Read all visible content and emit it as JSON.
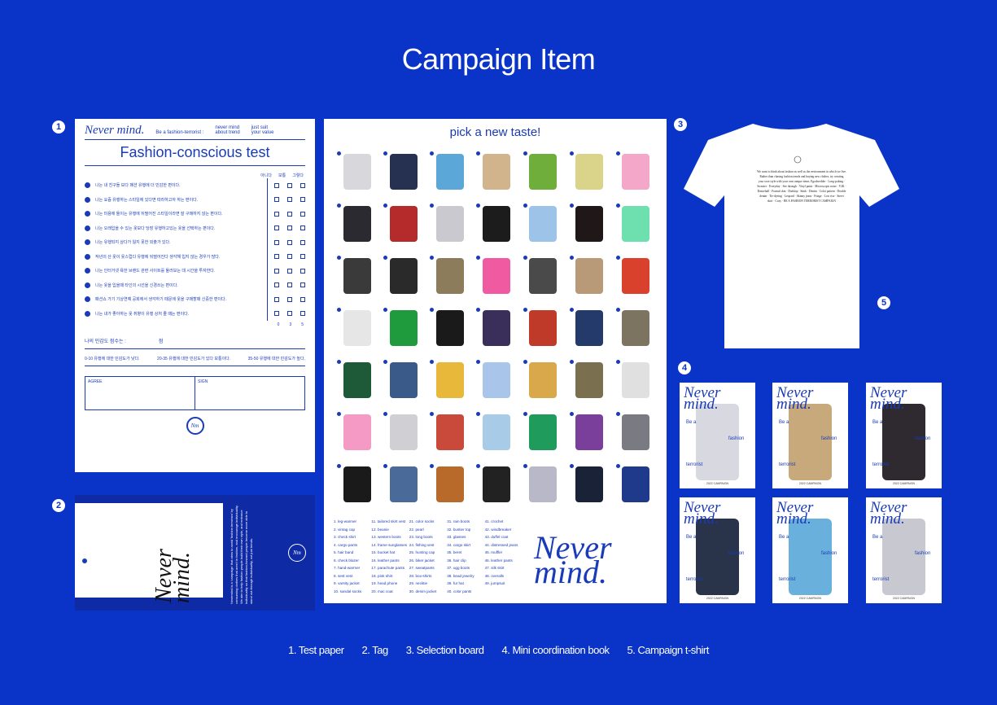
{
  "title": "Campaign Item",
  "markers": {
    "m1": "1",
    "m2": "2",
    "m3": "3",
    "m4": "4",
    "m5": "5"
  },
  "test_paper": {
    "logo": "Never mind.",
    "tagline": "Be a fashion-terrorist :",
    "line1": "never mind",
    "line1b": "about trend",
    "line2": "just suit",
    "line2b": "your value",
    "heading": "Fashion-conscious test",
    "options": [
      "아니다",
      "보통",
      "그렇다"
    ],
    "questions": [
      "나는 내 친구들 보다 패션 유행에 더 민감한 편이다.",
      "나는 요즘 유행하는 스타일에 있다면 따라하고자 하는 편이다.",
      "나는 미용에 들이는 유행에 뒤떨어진 스타일이라면 잘 구매하지 않는 편이다.",
      "나는 오래입을 수 있는 옷보다 당장 유행하고있는 옷을 선택하는 편이다.",
      "나는 유행되지 상다가 잃지 못한 외출가 있다.",
      "작년의 산 옷이 옷스럽다 유행에 뒤떨어진다 생각해 입지 않는 경우가 많다.",
      "나는 인터거넷 욕한 브랜드 관련 사이트를 둘러보는 데 시간을 투자한다.",
      "나는 옷을 입을때 타인의 시선을 신경쓰는 편이다.",
      "패션쇼 가기 기상연예 공회에서 생각하기 때문에 옷을 구매할때 신중한 편이다.",
      "나는 내가 좋아하는 옷 취향이 유행 상처 줄 때는 편이다."
    ],
    "score_label": "나의 민감도 점수는 :",
    "score_unit": "점",
    "col_totals": [
      "0",
      "3",
      "5"
    ],
    "levels": [
      "0-10  유행에 대한 민감도가 낮다.",
      "20-35  유행에 대한 민감도가 있다 보통이다.",
      "35-50  유행에 대한 민감도가 높다."
    ],
    "agree": "AGREE",
    "sign": "SIGN",
    "seal": "Nm"
  },
  "tag": {
    "brand": "Never mind.",
    "blurb": "Nevermind is a 'campaign' that aims to avoid 'fashion terrorism' by consuming clothes that aren't in fashion, and encourage individuality. We aim to help fashion people build their own style, and embrace individuality so that fashion-forward people become more able to stand out through individuality, not just trends.",
    "mark": "Nm"
  },
  "board": {
    "title": "pick a new taste!",
    "items": [
      {
        "c": "#d8d8dc"
      },
      {
        "c": "#263050"
      },
      {
        "c": "#5aa7d8"
      },
      {
        "c": "#d2b48c"
      },
      {
        "c": "#6fae3a"
      },
      {
        "c": "#d9d48a"
      },
      {
        "c": "#f4a7c8"
      },
      {
        "c": "#2a2a30"
      },
      {
        "c": "#b52a2a"
      },
      {
        "c": "#c9c9cf"
      },
      {
        "c": "#1c1c1c"
      },
      {
        "c": "#9ec3e8"
      },
      {
        "c": "#201818"
      },
      {
        "c": "#6ee0b0"
      },
      {
        "c": "#3a3a3a"
      },
      {
        "c": "#2a2a2a"
      },
      {
        "c": "#8c7c5c"
      },
      {
        "c": "#f05aa0"
      },
      {
        "c": "#4a4a4a"
      },
      {
        "c": "#b89a78"
      },
      {
        "c": "#d9412c"
      },
      {
        "c": "#e6e6e6"
      },
      {
        "c": "#1f9a3c"
      },
      {
        "c": "#1a1a1a"
      },
      {
        "c": "#3a2f5a"
      },
      {
        "c": "#c03a2a"
      },
      {
        "c": "#233a6a"
      },
      {
        "c": "#7c7460"
      },
      {
        "c": "#1f5a38"
      },
      {
        "c": "#3a5a8a"
      },
      {
        "c": "#e8b83a"
      },
      {
        "c": "#a9c6ea"
      },
      {
        "c": "#d9a84a"
      },
      {
        "c": "#7a7050"
      },
      {
        "c": "#e0e0e0"
      },
      {
        "c": "#f59ac4"
      },
      {
        "c": "#d0d0d4"
      },
      {
        "c": "#c94a3a"
      },
      {
        "c": "#a8cce8"
      },
      {
        "c": "#1f9c5c"
      },
      {
        "c": "#7a3f9a"
      },
      {
        "c": "#7a7a82"
      },
      {
        "c": "#1a1a1a"
      },
      {
        "c": "#4a6a9a"
      },
      {
        "c": "#b86a2a"
      },
      {
        "c": "#222222"
      },
      {
        "c": "#b8b8c8"
      },
      {
        "c": "#1a2238"
      },
      {
        "c": "#1f3a8a"
      }
    ],
    "legend": [
      "1. leg-warmer",
      "11. tailored skirt vest",
      "21. color socks",
      "31. rain boots",
      "41. crochet",
      "2. vintag cap",
      "12. beanie",
      "22. pearl",
      "32. bustier top",
      "42. windbreaker",
      "3. check shirt",
      "13. western boots",
      "23. long boots",
      "33. glasses",
      "43. duffel coat",
      "4. cargo pants",
      "14. frame sunglasses",
      "24. fishing vest",
      "34. cargo skirt",
      "44. distressed jeans",
      "5. hair band",
      "15. bucket hat",
      "25. hunting cap",
      "35. beret",
      "45. muffler",
      "6. check blazer",
      "16. leather pants",
      "26. biker jacket",
      "36. hair clip",
      "46. leather pants",
      "7. hand-warmer",
      "17. parachute pants",
      "27. sweatpants",
      "37. ugg boots",
      "47. silk skirt",
      "8. sest vest",
      "18. pink shirt",
      "28. box-shirts",
      "38. bead jewelry",
      "48. overalls",
      "9. varsity jacket",
      "19. head phone",
      "29. necktie",
      "39. fur hat",
      "49. jumpsuit",
      "10. sandal socks",
      "20. mac coat",
      "30. denim jacket",
      "40. color pants",
      ""
    ],
    "brand": "Never mind."
  },
  "shirt": {
    "text": "We want to think about fashion as well as the environment in which we live. Rather than chasing fashion trends and buying new clothes, try creating your own style with your own unique items. Egoshredder · Long-poking · Sweater · Everyday · See through · Vinyl pants · Microscopic noise · Y2K · Dancehall · Formal skin · Dadslop · Stink · Denim · Color pattern · Double denim · Tie-dyeing · Leopard · Skinny jeans · Fringe · Low rise · Street skirt · Cozy · BE A FASHION TERRORIST CAMPAIGN"
  },
  "books": [
    {
      "brand": "Never mind.",
      "be": "Be a",
      "fashion": "fashion",
      "terrorist": "terrorist",
      "year": "2022 CAMPAIGN",
      "c": "#d8d8e0"
    },
    {
      "brand": "Never mind.",
      "be": "Be a",
      "fashion": "fashion",
      "terrorist": "terrorist",
      "year": "2022 CAMPAIGN",
      "c": "#c7a97c"
    },
    {
      "brand": "Never mind.",
      "be": "Be a",
      "fashion": "fashion",
      "terrorist": "terrorist",
      "year": "2022 CAMPAIGN",
      "c": "#2f2a30"
    },
    {
      "brand": "Never mind.",
      "be": "Be a",
      "fashion": "fashion",
      "terrorist": "terrorist",
      "year": "2022 CAMPAIGN",
      "c": "#29334a"
    },
    {
      "brand": "Never mind.",
      "be": "Be a",
      "fashion": "fashion",
      "terrorist": "terrorist",
      "year": "2022 CAMPAIGN",
      "c": "#6ab0dd"
    },
    {
      "brand": "Never mind.",
      "be": "Be a",
      "fashion": "fashion",
      "terrorist": "terrorist",
      "year": "2022 CAMPAIGN",
      "c": "#c8c8d0"
    }
  ],
  "captions": [
    "1. Test paper",
    "2. Tag",
    "3. Selection board",
    "4. Mini coordination book",
    "5. Campaign t-shirt"
  ]
}
